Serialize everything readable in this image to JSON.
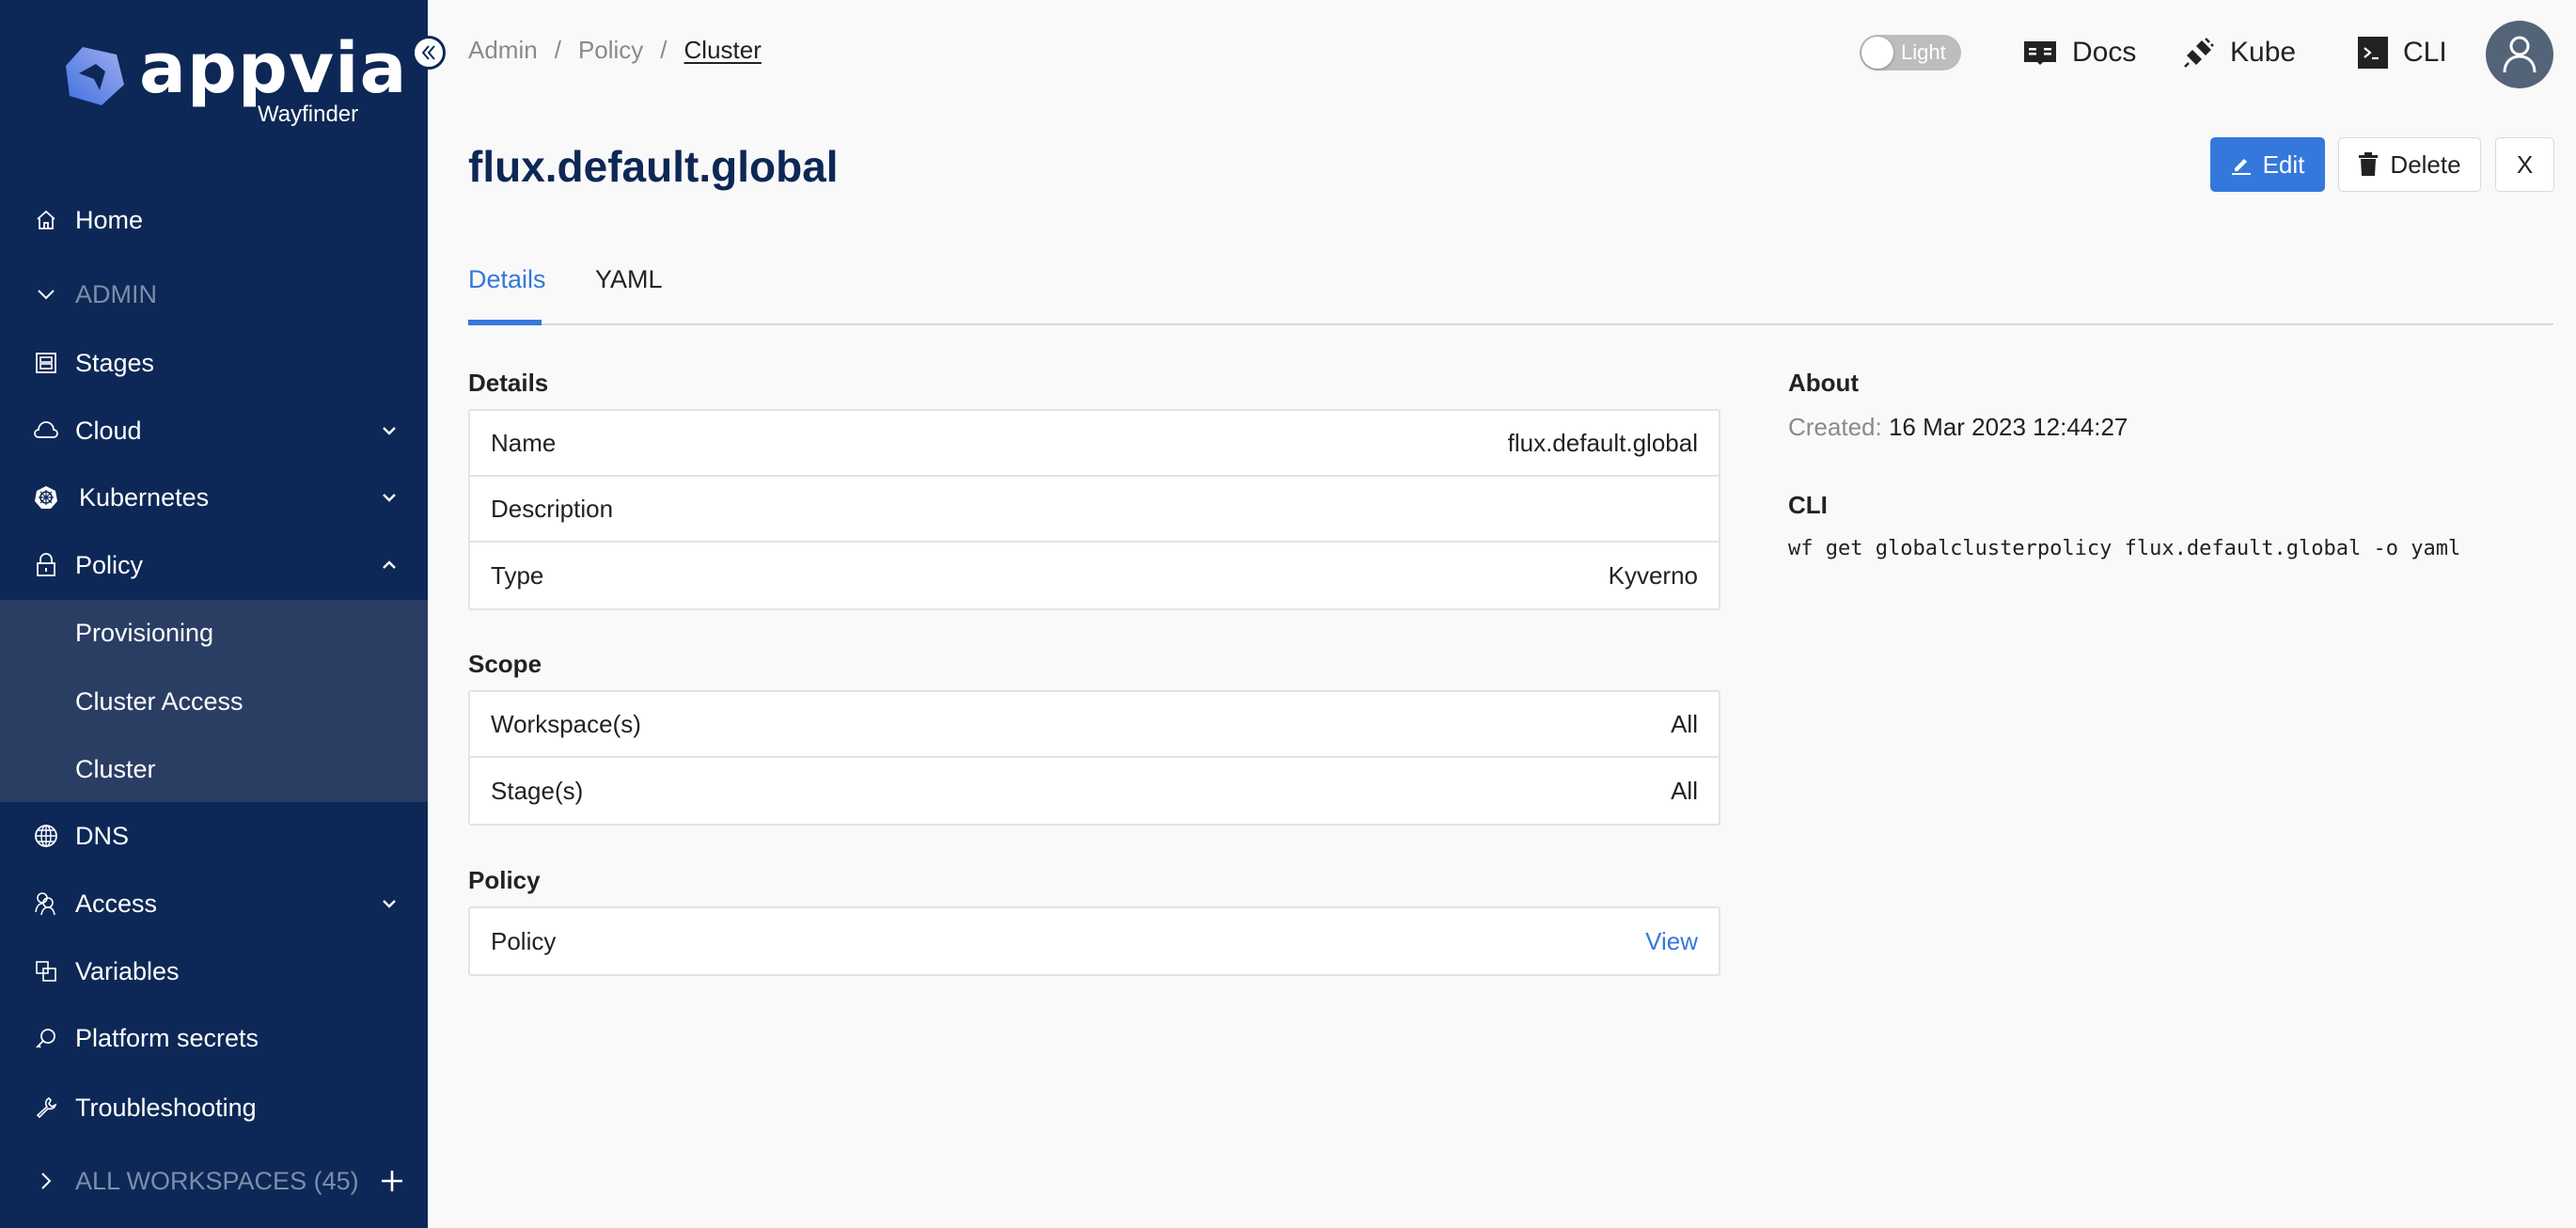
{
  "brand": {
    "name": "appvia",
    "product": "Wayfinder",
    "colors": {
      "sidebar": "#0d2856",
      "submenu": "#2a3d63",
      "accent": "#3478dc"
    }
  },
  "sidebar": {
    "items": [
      {
        "label": "Home",
        "icon": "home-icon"
      },
      {
        "label": "ADMIN",
        "icon": "chevron-down-icon",
        "section": true
      },
      {
        "label": "Stages",
        "icon": "stages-icon"
      },
      {
        "label": "Cloud",
        "icon": "cloud-icon",
        "expandable": true,
        "expanded": false
      },
      {
        "label": "Kubernetes",
        "icon": "kubernetes-icon",
        "expandable": true,
        "expanded": false
      },
      {
        "label": "Policy",
        "icon": "lock-icon",
        "expandable": true,
        "expanded": true
      },
      {
        "label": "DNS",
        "icon": "globe-icon"
      },
      {
        "label": "Access",
        "icon": "users-icon",
        "expandable": true,
        "expanded": false
      },
      {
        "label": "Variables",
        "icon": "variables-icon"
      },
      {
        "label": "Platform secrets",
        "icon": "key-icon"
      },
      {
        "label": "Troubleshooting",
        "icon": "wrench-icon"
      }
    ],
    "policy_submenu": [
      {
        "label": "Provisioning"
      },
      {
        "label": "Cluster Access"
      },
      {
        "label": "Cluster",
        "active": true
      }
    ],
    "workspaces": {
      "label": "ALL WORKSPACES (45)",
      "icon": "chevron-right-icon",
      "add_icon": "plus-icon"
    }
  },
  "header": {
    "breadcrumb": [
      {
        "label": "Admin"
      },
      {
        "label": "Policy"
      },
      {
        "label": "Cluster",
        "current": true
      }
    ],
    "separator": "/",
    "theme_toggle": {
      "label": "Light",
      "on": false
    },
    "links": [
      {
        "label": "Docs",
        "icon": "book-icon"
      },
      {
        "label": "Kube",
        "icon": "plug-icon"
      },
      {
        "label": "CLI",
        "icon": "terminal-icon"
      }
    ],
    "avatar_icon": "user-icon"
  },
  "page": {
    "title": "flux.default.global",
    "actions": {
      "edit": "Edit",
      "delete": "Delete",
      "close": "X"
    },
    "tabs": [
      {
        "label": "Details",
        "active": true
      },
      {
        "label": "YAML",
        "active": false
      }
    ]
  },
  "details": {
    "title": "Details",
    "rows": [
      {
        "label": "Name",
        "value": "flux.default.global"
      },
      {
        "label": "Description",
        "value": ""
      },
      {
        "label": "Type",
        "value": "Kyverno"
      }
    ]
  },
  "scope": {
    "title": "Scope",
    "rows": [
      {
        "label": "Workspace(s)",
        "value": "All"
      },
      {
        "label": "Stage(s)",
        "value": "All"
      }
    ]
  },
  "policy": {
    "title": "Policy",
    "rows": [
      {
        "label": "Policy",
        "value": "View",
        "link": true
      }
    ]
  },
  "about": {
    "title": "About",
    "created_label": "Created:",
    "created_value": "16 Mar 2023 12:44:27",
    "cli_title": "CLI",
    "cli_command": "wf get globalclusterpolicy flux.default.global -o yaml"
  }
}
